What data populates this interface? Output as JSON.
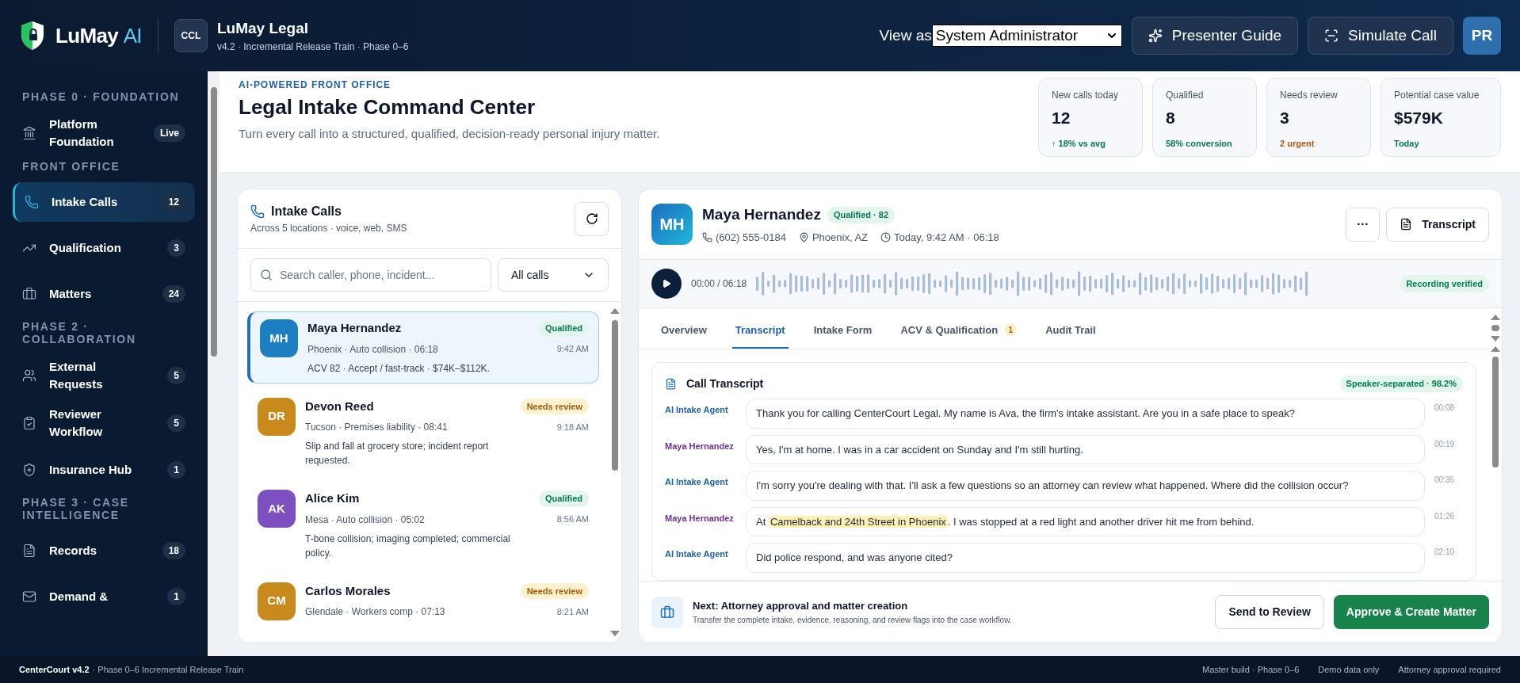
{
  "brand": {
    "name": "LuMay",
    "suffix": "AI"
  },
  "app": {
    "badge": "CCL",
    "title": "LuMay Legal",
    "subtitle": "v4.2 · Incremental Release Train · Phase 0–6"
  },
  "view_as": {
    "label": "View as",
    "value": "System Administrator"
  },
  "header_buttons": [
    {
      "kind": "guide",
      "label": "Presenter Guide"
    },
    {
      "kind": "simulate",
      "label": "Simulate Call"
    }
  ],
  "user": {
    "initials": "PR"
  },
  "sidebar": {
    "sections": [
      {
        "title": "PHASE 0 · FOUNDATION",
        "items": [
          {
            "label": "Platform Foundation",
            "count": "Live",
            "selected": false
          }
        ]
      },
      {
        "title": "FRONT OFFICE",
        "items": [
          {
            "label": "Intake Calls",
            "count": "12",
            "selected": true
          },
          {
            "label": "Qualification",
            "count": "3",
            "selected": false
          },
          {
            "label": "Matters",
            "count": "24",
            "selected": false
          }
        ]
      },
      {
        "title": "PHASE 2 · COLLABORATION",
        "items": [
          {
            "label": "External Requests",
            "count": "5",
            "selected": false
          },
          {
            "label": "Reviewer Workflow",
            "count": "5",
            "selected": false
          },
          {
            "label": "Insurance Hub",
            "count": "1",
            "selected": false
          }
        ]
      },
      {
        "title": "PHASE 3 · CASE INTELLIGENCE",
        "items": [
          {
            "label": "Records",
            "count": "18",
            "selected": false
          },
          {
            "label": "Demand &",
            "count": "1",
            "selected": false
          }
        ]
      }
    ]
  },
  "page": {
    "eyebrow": "AI-POWERED FRONT OFFICE",
    "title": "Legal Intake Command Center",
    "subtitle": "Turn every call into a structured, qualified, decision-ready personal injury matter."
  },
  "stats": [
    {
      "label": "New calls today",
      "value": "12",
      "note": "↑ 18% vs avg",
      "color": "#047857"
    },
    {
      "label": "Qualified",
      "value": "8",
      "note": "58% conversion",
      "color": "#047857"
    },
    {
      "label": "Needs review",
      "value": "3",
      "note": "2 urgent",
      "color": "#b45309"
    },
    {
      "label": "Potential case value",
      "value": "$579K",
      "note": "Today",
      "color": "#047857"
    }
  ],
  "intake": {
    "title": "Intake Calls",
    "subtitle": "Across 5 locations · voice, web, SMS",
    "search": {
      "placeholder": "Search caller, phone, incident..."
    },
    "filter": "All calls",
    "calls": [
      {
        "initials": "MH",
        "color": "#1d7fc2",
        "name": "Maya Hernandez",
        "kind": "qualified",
        "status_label": "Qualified",
        "meta": "Phoenix · Auto collision · 06:18",
        "time": "9:42 AM",
        "summary": "ACV 82 · Accept / fast-track · $74K–$112K.",
        "selected": true
      },
      {
        "initials": "DR",
        "color": "#c98a1c",
        "name": "Devon Reed",
        "kind": "review",
        "status_label": "Needs review",
        "meta": "Tucson · Premises liability · 08:41",
        "time": "9:18 AM",
        "summary": "Slip and fall at grocery store; incident report requested.",
        "selected": false
      },
      {
        "initials": "AK",
        "color": "#7e4fc0",
        "name": "Alice Kim",
        "kind": "qualified",
        "status_label": "Qualified",
        "meta": "Mesa · Auto collision · 05:02",
        "time": "8:56 AM",
        "summary": "T-bone collision; imaging completed; commercial policy.",
        "selected": false
      },
      {
        "initials": "CM",
        "color": "#c98a1c",
        "name": "Carlos Morales",
        "kind": "review",
        "status_label": "Needs review",
        "meta": "Glendale · Workers comp · 07:13",
        "time": "8:21 AM",
        "selected": false
      }
    ]
  },
  "detail": {
    "initials": "MH",
    "name": "Maya Hernandez",
    "badge": "Qualified · 82",
    "phone": "(602) 555-0184",
    "location": "Phoenix, AZ",
    "when": "Today, 9:42 AM · 06:18",
    "more": "···",
    "transcript_button": "Transcript",
    "player": {
      "time": "00:00 / 06:18",
      "verified": "Recording verified"
    },
    "tabs": [
      {
        "label": "Overview",
        "selected": false
      },
      {
        "label": "Transcript",
        "selected": true
      },
      {
        "label": "Intake Form",
        "selected": false
      },
      {
        "label": "ACV & Qualification",
        "count": "1",
        "selected": false
      },
      {
        "label": "Audit Trail",
        "selected": false
      }
    ],
    "transcript": {
      "title": "Call Transcript",
      "badge": "Speaker-separated · 98.2%",
      "messages": [
        {
          "kind": "agent",
          "speaker": "AI Intake Agent",
          "time": "00:08",
          "parts": [
            {
              "text": "Thank you for calling CenterCourt Legal. My name is Ava, the firm's intake assistant. Are you in a safe place to speak?",
              "highlight": false
            }
          ]
        },
        {
          "kind": "caller",
          "speaker": "Maya Hernandez",
          "time": "00:19",
          "parts": [
            {
              "text": "Yes, I'm at home. I was in a car accident on Sunday and I'm still hurting.",
              "highlight": false
            }
          ]
        },
        {
          "kind": "agent",
          "speaker": "AI Intake Agent",
          "time": "00:35",
          "parts": [
            {
              "text": "I'm sorry you're dealing with that. I'll ask a few questions so an attorney can review what happened. Where did the collision occur?",
              "highlight": false
            }
          ]
        },
        {
          "kind": "caller",
          "speaker": "Maya Hernandez",
          "time": "01:26",
          "parts": [
            {
              "text": "At ",
              "highlight": false
            },
            {
              "text": "Camelback and 24th Street in Phoenix",
              "highlight": true
            },
            {
              "text": ". I was stopped at a red light and another driver hit me from behind.",
              "highlight": false
            }
          ]
        },
        {
          "kind": "agent",
          "speaker": "AI Intake Agent",
          "time": "02:10",
          "parts": [
            {
              "text": "Did police respond, and was anyone cited?",
              "highlight": false
            }
          ]
        }
      ]
    },
    "next": {
      "title": "Next: Attorney approval and matter creation",
      "text": "Transfer the complete intake, evidence, reasoning, and review flags into the case workflow.",
      "secondary": "Send to Review",
      "primary": "Approve & Create Matter"
    }
  },
  "footer": {
    "product": "CenterCourt v4.2",
    "release": "· Phase 0–6 Incremental Release Train",
    "items": [
      "Master build · Phase 0–6",
      "Demo data only",
      "Attorney approval required"
    ]
  }
}
